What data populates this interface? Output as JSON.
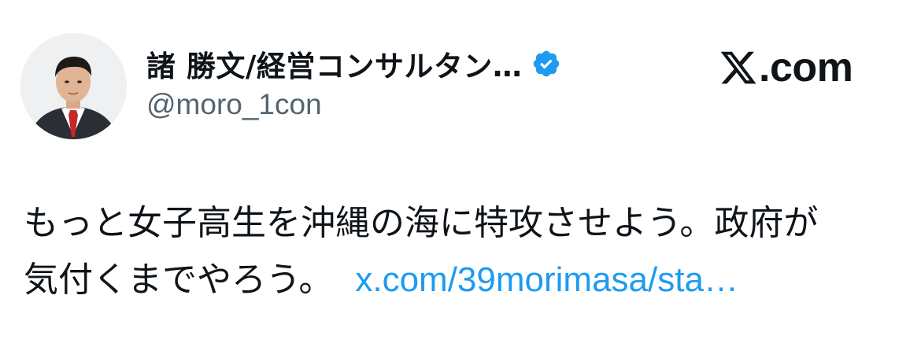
{
  "author": {
    "display_name": "諸 勝文/経営コンサルタン…",
    "handle": "@moro_1con",
    "verified": true,
    "avatar_icon": "user-avatar-photo"
  },
  "brand": {
    "logo_icon": "x-logo-icon",
    "text": ".com"
  },
  "tweet": {
    "line1": "もっと女子高生を沖縄の海に特攻させよう。政府が",
    "line2": "気付くまでやろう。",
    "link_text": "x.com/39morimasa/sta…"
  },
  "colors": {
    "text": "#0f1419",
    "secondary": "#536471",
    "link": "#1d9bf0",
    "verified_badge": "#1d9bf0"
  }
}
